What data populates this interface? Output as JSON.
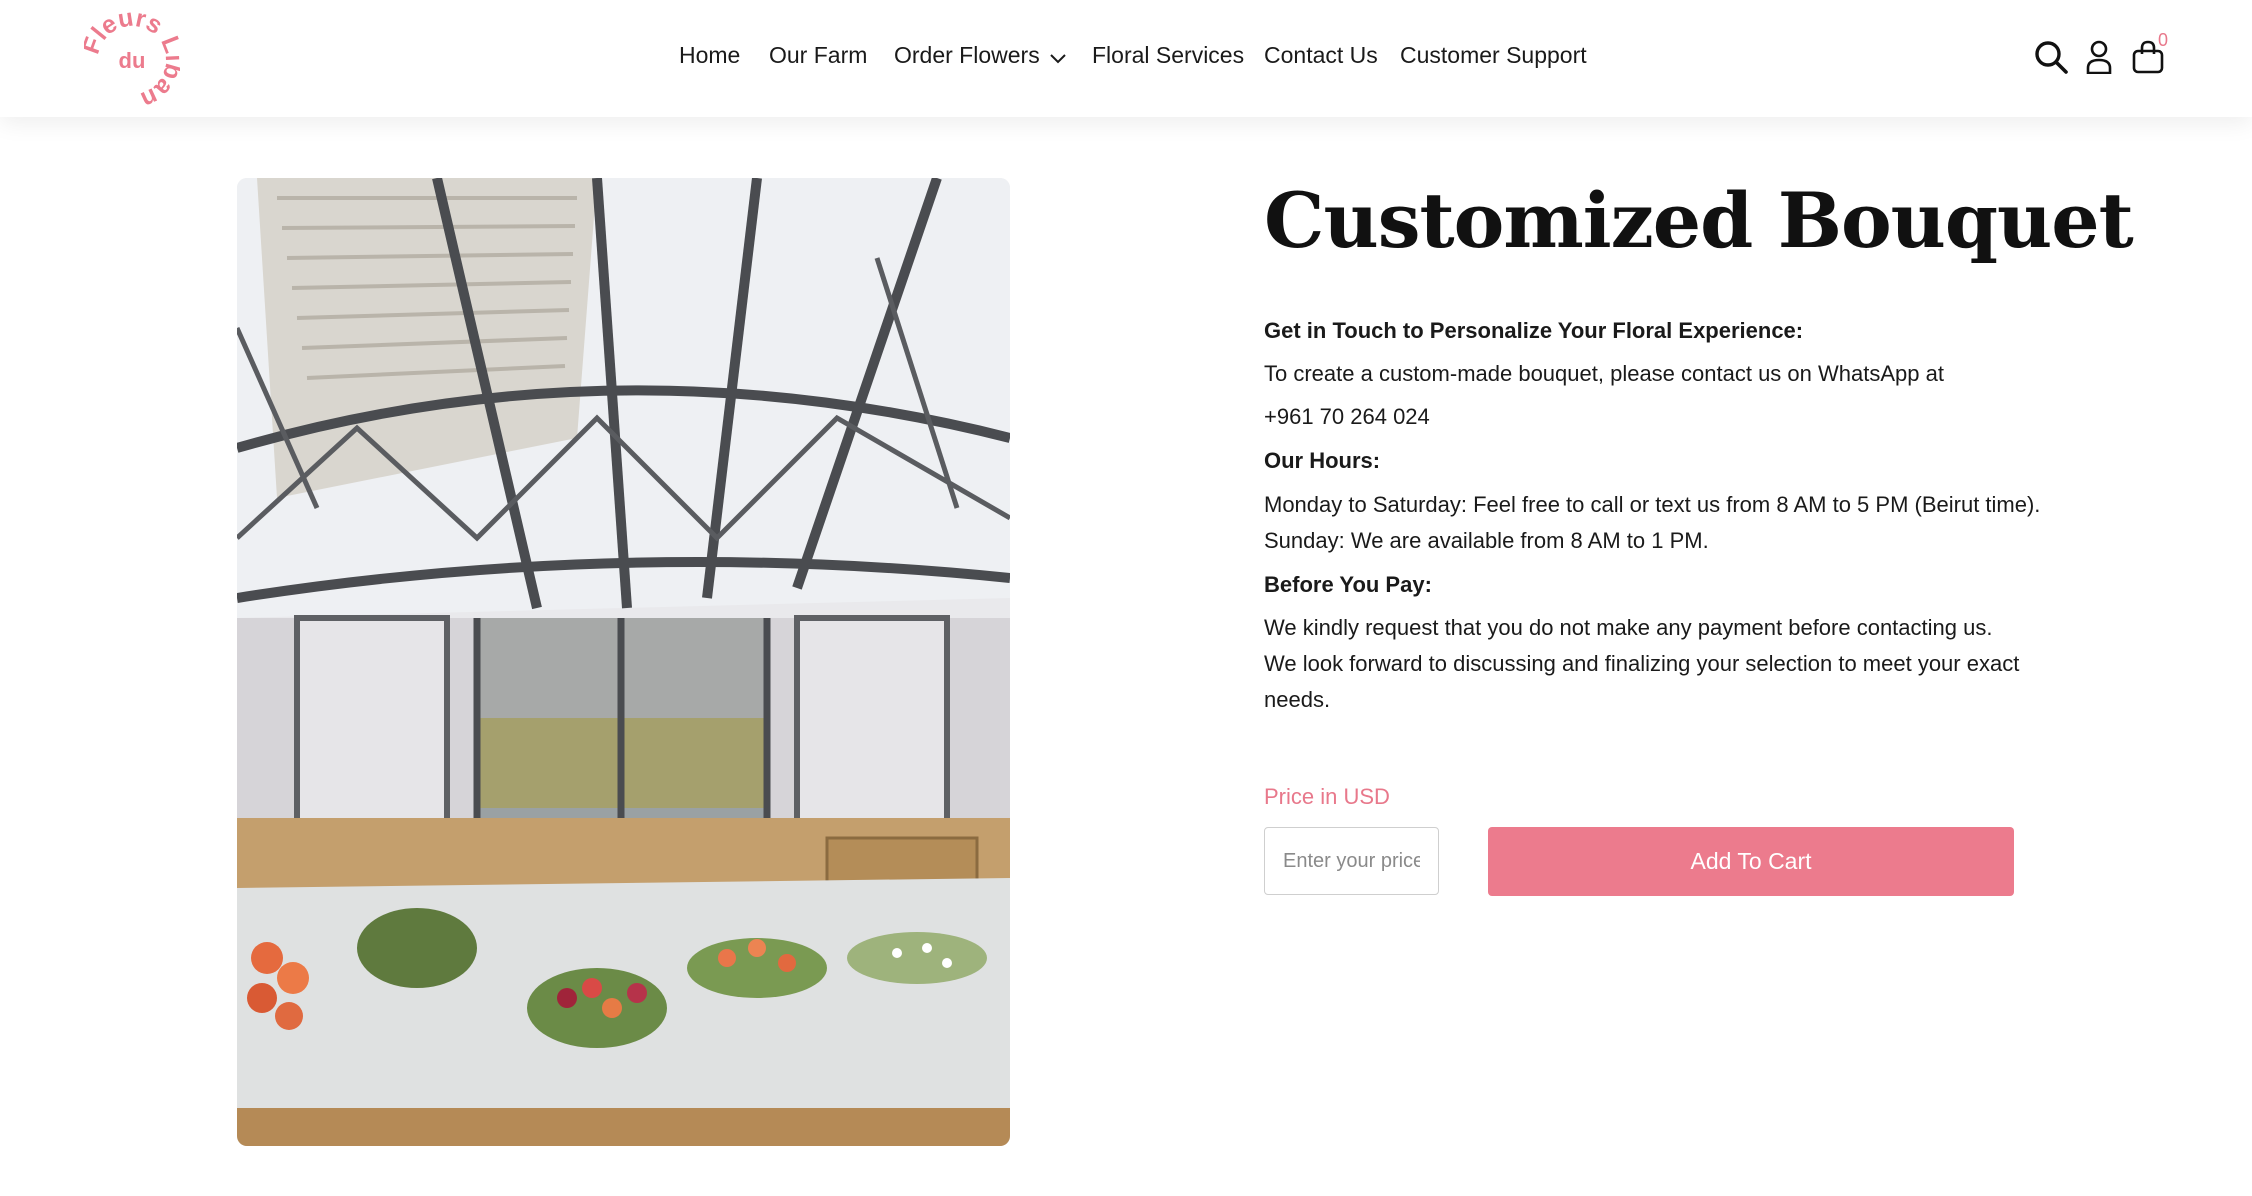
{
  "brand": {
    "logo_text": "Fleurs du Liban",
    "accent_color": "#ec7b8d"
  },
  "nav": {
    "items": [
      {
        "label": "Home"
      },
      {
        "label": "Our Farm"
      },
      {
        "label": "Order Flowers",
        "has_dropdown": true
      },
      {
        "label": "Floral Services"
      },
      {
        "label": "Contact Us"
      },
      {
        "label": "Customer Support"
      }
    ]
  },
  "header_icons": {
    "search": "search-icon",
    "account": "user-icon",
    "cart": "shopping-bag-icon",
    "cart_count": "0"
  },
  "product": {
    "image_alt": "Greenhouse interior with flower bouquets laid out on a table",
    "title": "Customized Bouquet",
    "sections": {
      "contact_heading": "Get in Touch to Personalize Your Floral Experience:",
      "contact_text": "To create a custom-made bouquet, please contact us on WhatsApp at",
      "phone": "+961 70 264 024",
      "hours_heading": "Our Hours:",
      "hours_weekdays": "Monday to Saturday: Feel free to call or text us from 8 AM to 5 PM (Beirut time).",
      "hours_sunday": "Sunday: We are available from 8 AM to 1 PM.",
      "pay_heading": "Before You Pay:",
      "pay_text": "We kindly request that you do not make any payment before contacting us. We look forward to discussing and finalizing your selection to meet your exact needs."
    },
    "price_label": "Price in USD",
    "price_placeholder": "Enter your price",
    "price_value": "",
    "add_to_cart_label": "Add To Cart"
  }
}
